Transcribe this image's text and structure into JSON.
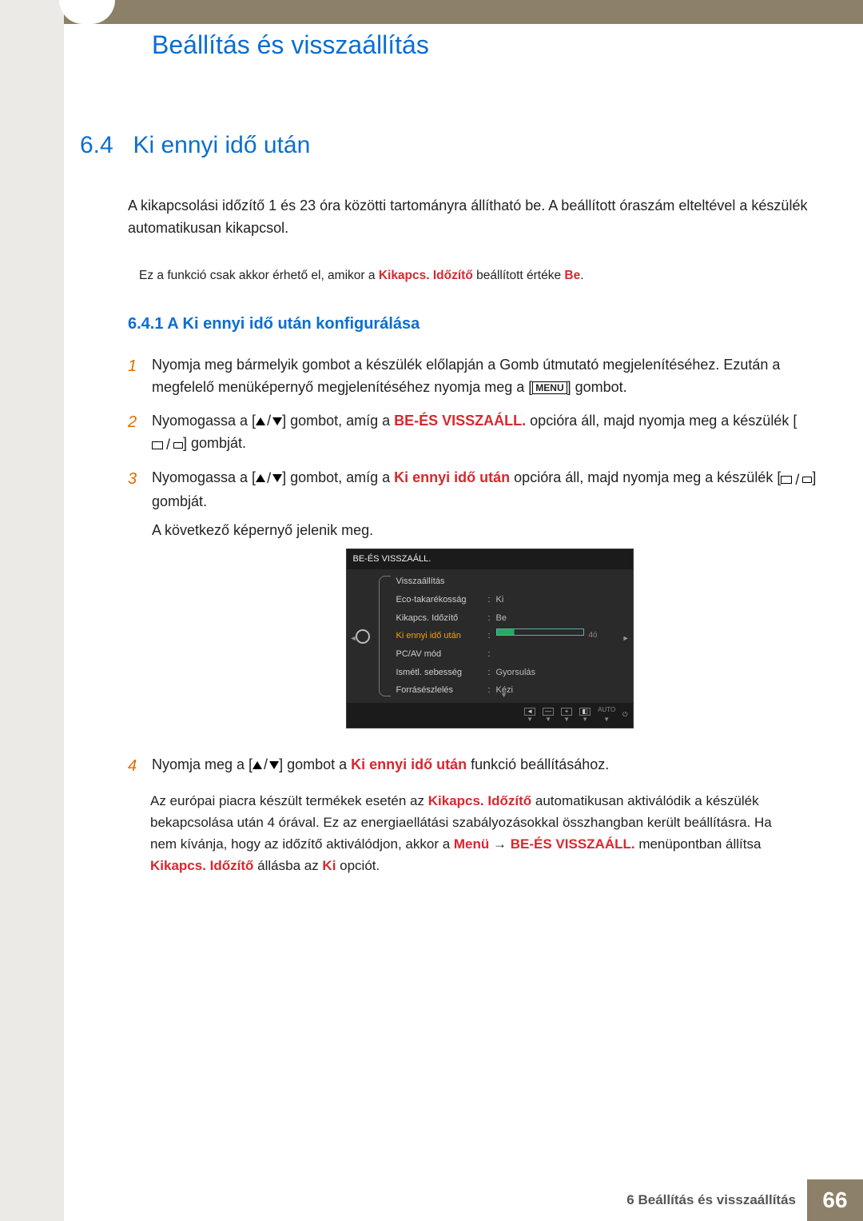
{
  "chapter_title": "Beállítás és visszaállítás",
  "section": {
    "num": "6.4",
    "title": "Ki ennyi idő után"
  },
  "intro": "A kikapcsolási időzítő 1 és 23 óra közötti tartományra állítható be. A beállított óraszám elteltével a készülék automatikusan kikapcsol.",
  "note1": {
    "pre": "Ez a funkció csak akkor érhető el, amikor a ",
    "em1": "Kikapcs. Időzítő",
    "mid": " beállított értéke ",
    "em2": "Be",
    "post": "."
  },
  "subsection": "6.4.1  A Ki ennyi idő után konfigurálása",
  "steps": {
    "s1": {
      "a": "Nyomja meg bármelyik gombot a készülék előlapján a Gomb útmutató megjelenítéséhez. Ezután a megfelelő menüképernyő megjelenítéséhez nyomja meg a [",
      "menu": "MENU",
      "b": "] gombot."
    },
    "s2": {
      "a": "Nyomogassa a [",
      "b": "] gombot, amíg a ",
      "em": "BE-ÉS VISSZAÁLL.",
      "c": " opcióra áll, majd nyomja meg a készülék [",
      "d": "] gombját."
    },
    "s3": {
      "a": "Nyomogassa a [",
      "b": "] gombot, amíg a ",
      "em": "Ki ennyi idő után",
      "c": " opcióra áll, majd nyomja meg a készülék [",
      "d": "] gombját.",
      "after": "A következő képernyő jelenik meg."
    },
    "s4": {
      "a": "Nyomja meg a [",
      "b": "] gombot a ",
      "em": "Ki ennyi idő után",
      "c": " funkció beállításához."
    }
  },
  "osd": {
    "title": "BE-ÉS VISSZAÁLL.",
    "rows": [
      {
        "label": "Visszaállítás",
        "value": ""
      },
      {
        "label": "Eco-takarékosság",
        "value": "Ki"
      },
      {
        "label": "Kikapcs. Időzítő",
        "value": "Be"
      },
      {
        "label": "Ki ennyi idő után",
        "value": "",
        "hl": true,
        "slider": true,
        "slider_val": "4ó"
      },
      {
        "label": "PC/AV mód",
        "value": ""
      },
      {
        "label": "Ismétl. sebesség",
        "value": "Gyorsulás"
      },
      {
        "label": "Forrásészlelés",
        "value": "Kézi"
      }
    ],
    "footer_auto": "AUTO"
  },
  "note2": {
    "a": "Az európai piacra készült termékek esetén az ",
    "em1": "Kikapcs. Időzítő",
    "b": " automatikusan aktiválódik a készülék bekapcsolása után 4 órával. Ez az energiaellátási szabályozásokkal összhangban került beállításra. Ha nem kívánja, hogy az időzítő aktiválódjon, akkor a ",
    "em2": "Menü",
    "arrow": " → ",
    "em3": "BE-ÉS VISSZAÁLL.",
    "c": " menüpontban állítsa ",
    "em4": "Kikapcs. Időzítő",
    "d": " állásba az ",
    "em5": "Ki",
    "e": " opciót."
  },
  "footer": {
    "label": "6 Beállítás és visszaállítás",
    "page": "66"
  }
}
